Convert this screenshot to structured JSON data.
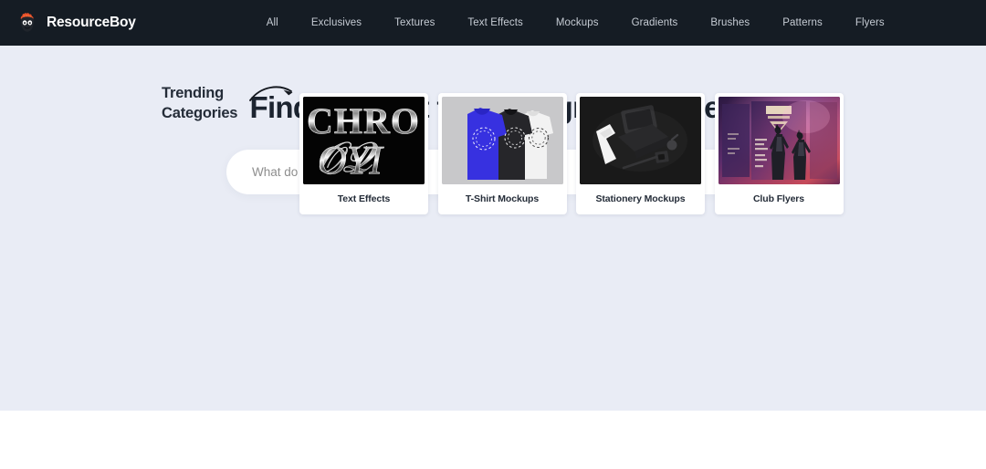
{
  "header": {
    "brand_name": "ResourceBoy",
    "logo_icon": "mascot-icon",
    "nav_items": [
      {
        "label": "All"
      },
      {
        "label": "Exclusives"
      },
      {
        "label": "Textures"
      },
      {
        "label": "Text Effects"
      },
      {
        "label": "Mockups"
      },
      {
        "label": "Gradients"
      },
      {
        "label": "Brushes"
      },
      {
        "label": "Patterns"
      },
      {
        "label": "Flyers"
      }
    ],
    "background_color": "#151C24",
    "nav_text_color": "#C6CCD4"
  },
  "hero": {
    "title": "Find the best free design resources",
    "background_color": "#E9ECF5",
    "title_color": "#1C2430"
  },
  "search": {
    "placeholder": "What do you want to download?",
    "value": "",
    "button_icon": "search-icon",
    "button_color": "#F4613C"
  },
  "trending": {
    "label_line1": "Trending",
    "label_line2": "Categories",
    "arrow_icon": "curved-arrow-right-icon",
    "cards": [
      {
        "label": "Text Effects",
        "thumb": "chrome-text-effect-thumbnail"
      },
      {
        "label": "T-Shirt Mockups",
        "thumb": "tshirt-mockup-thumbnail"
      },
      {
        "label": "Stationery Mockups",
        "thumb": "stationery-mockup-thumbnail"
      },
      {
        "label": "Club Flyers",
        "thumb": "club-flyer-thumbnail"
      }
    ]
  }
}
